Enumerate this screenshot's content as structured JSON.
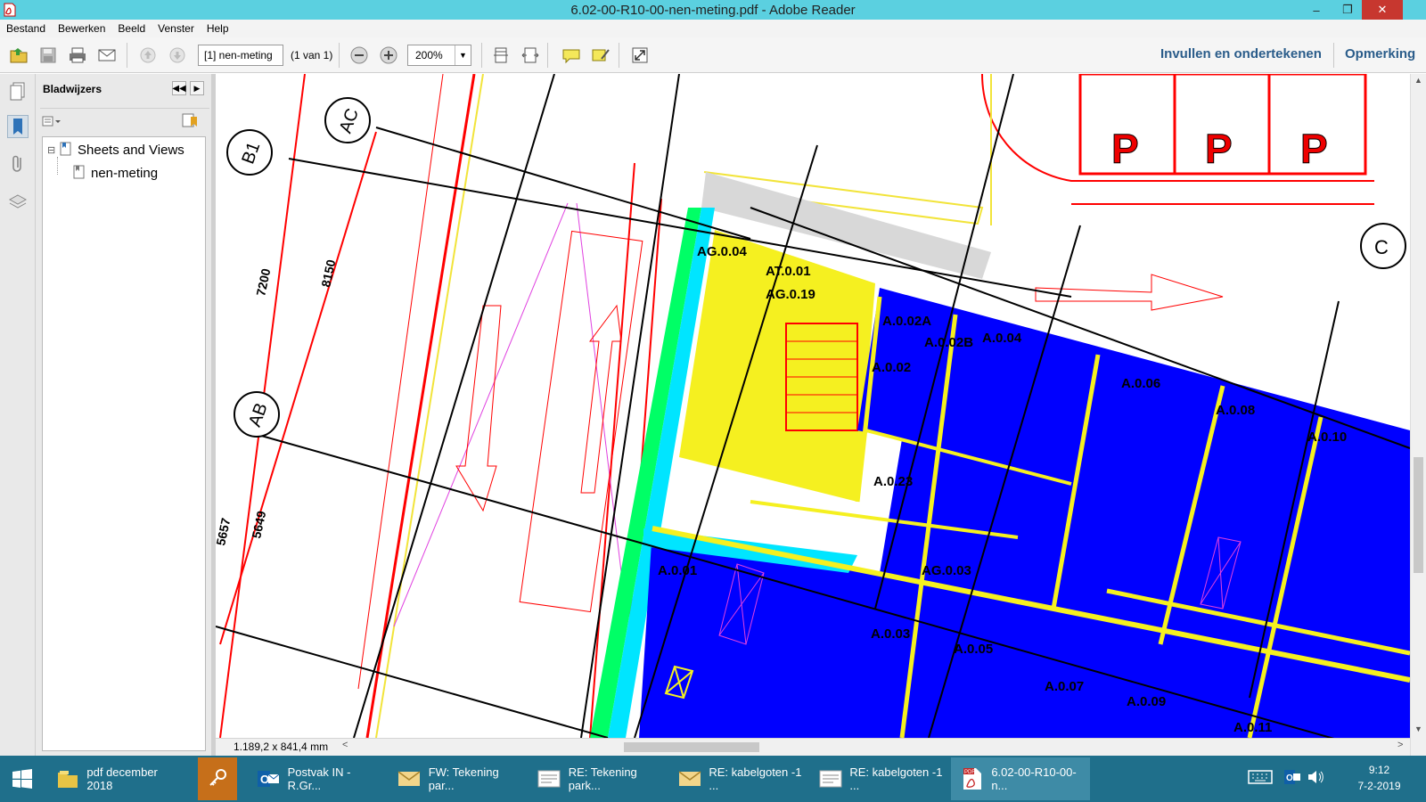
{
  "window": {
    "title": "6.02-00-R10-00-nen-meting.pdf - Adobe Reader",
    "controls": [
      "–",
      "❐",
      "✕"
    ]
  },
  "menu": {
    "items": [
      "Bestand",
      "Bewerken",
      "Beeld",
      "Venster",
      "Help"
    ]
  },
  "toolbar": {
    "page_field": "[1] nen-meting",
    "page_count": "(1 van 1)",
    "zoom": "200%",
    "fill_sign": "Invullen en ondertekenen",
    "comment": "Opmerking"
  },
  "bookmarks": {
    "header": "Bladwijzers",
    "tree": [
      {
        "label": "Sheets and Views",
        "expander": "⊟"
      },
      {
        "label": "nen-meting"
      }
    ]
  },
  "status": {
    "page_size": "1.189,2 x 841,4 mm"
  },
  "drawing": {
    "grid_labels": [
      "AC",
      "B1",
      "AB",
      "C"
    ],
    "dimensions": [
      "7200",
      "8150",
      "5657",
      "5649"
    ],
    "parking_mark": "P",
    "room_labels": [
      "AG.0.04",
      "AT.0.01",
      "AG.0.19",
      "A.0.02A",
      "A.0.02B",
      "A.0.04",
      "A.0.02",
      "A.0.06",
      "A.0.08",
      "A.0.10",
      "A.0.23",
      "A.0.01",
      "AG.0.03",
      "A.0.03",
      "A.0.05",
      "A.0.07",
      "A.0.09",
      "A.0.11"
    ]
  },
  "taskbar": {
    "items": [
      {
        "label": "pdf december 2018",
        "icon": "folder-icon"
      },
      {
        "label": "",
        "icon": "key-icon"
      },
      {
        "label": "Postvak IN - R.Gr...",
        "icon": "outlook-icon"
      },
      {
        "label": "FW: Tekening par...",
        "icon": "mail-icon"
      },
      {
        "label": "RE: Tekening park...",
        "icon": "message-icon"
      },
      {
        "label": "RE: kabelgoten -1 ...",
        "icon": "mail-icon"
      },
      {
        "label": "RE: kabelgoten -1 ...",
        "icon": "message-icon"
      },
      {
        "label": "6.02-00-R10-00-n...",
        "icon": "pdf-icon"
      }
    ],
    "time": "9:12",
    "date": "7-2-2019"
  },
  "colors": {
    "title_bar": "#5bd0e0",
    "taskbar": "#1f6f8b",
    "room_fill": "#0000ff",
    "stair_fill": "#f5f020",
    "drawing_red": "#ff0000",
    "link_blue": "#2a5c8a"
  }
}
